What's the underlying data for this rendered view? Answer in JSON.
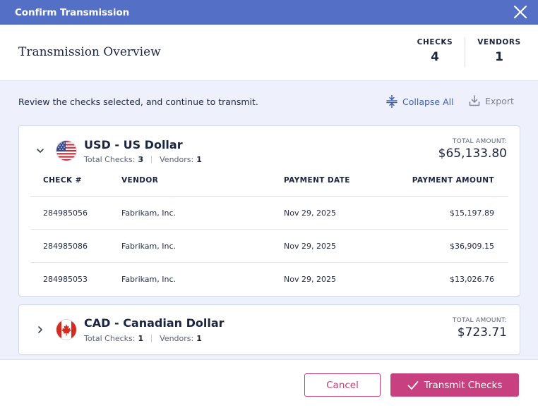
{
  "dialog": {
    "title": "Confirm Transmission"
  },
  "overview": {
    "heading": "Transmission Overview",
    "checks_label": "CHECKS",
    "checks_value": "4",
    "vendors_label": "VENDORS",
    "vendors_value": "1"
  },
  "toolbar": {
    "instructions": "Review the checks selected, and continue to transmit.",
    "collapse_label": "Collapse All",
    "export_label": "Export"
  },
  "columns": {
    "check": "CHECK #",
    "vendor": "VENDOR",
    "date": "PAYMENT DATE",
    "amount": "PAYMENT AMOUNT"
  },
  "groups": [
    {
      "currency": "USD - US Dollar",
      "flag": "us-flag",
      "expanded": true,
      "total_checks_label": "Total Checks:",
      "total_checks": "3",
      "vendors_label": "Vendors:",
      "vendors": "1",
      "total_amount_label": "TOTAL AMOUNT:",
      "total_amount": "$65,133.80",
      "rows": [
        {
          "check": "284985056",
          "vendor": "Fabrikam, Inc.",
          "date": "Nov 29, 2025",
          "amount": "$15,197.89"
        },
        {
          "check": "284985086",
          "vendor": "Fabrikam, Inc.",
          "date": "Nov 29, 2025",
          "amount": "$36,909.15"
        },
        {
          "check": "284985053",
          "vendor": "Fabrikam, Inc.",
          "date": "Nov 29, 2025",
          "amount": "$13,026.76"
        }
      ]
    },
    {
      "currency": "CAD - Canadian Dollar",
      "flag": "canada-flag",
      "expanded": false,
      "total_checks_label": "Total Checks:",
      "total_checks": "1",
      "vendors_label": "Vendors:",
      "vendors": "1",
      "total_amount_label": "TOTAL AMOUNT:",
      "total_amount": "$723.71"
    }
  ],
  "footer": {
    "cancel_label": "Cancel",
    "transmit_label": "Transmit Checks"
  },
  "colors": {
    "header": "#5470c6",
    "accent": "#c8407f",
    "link": "#3f5fb0",
    "background": "#eef1fb"
  }
}
